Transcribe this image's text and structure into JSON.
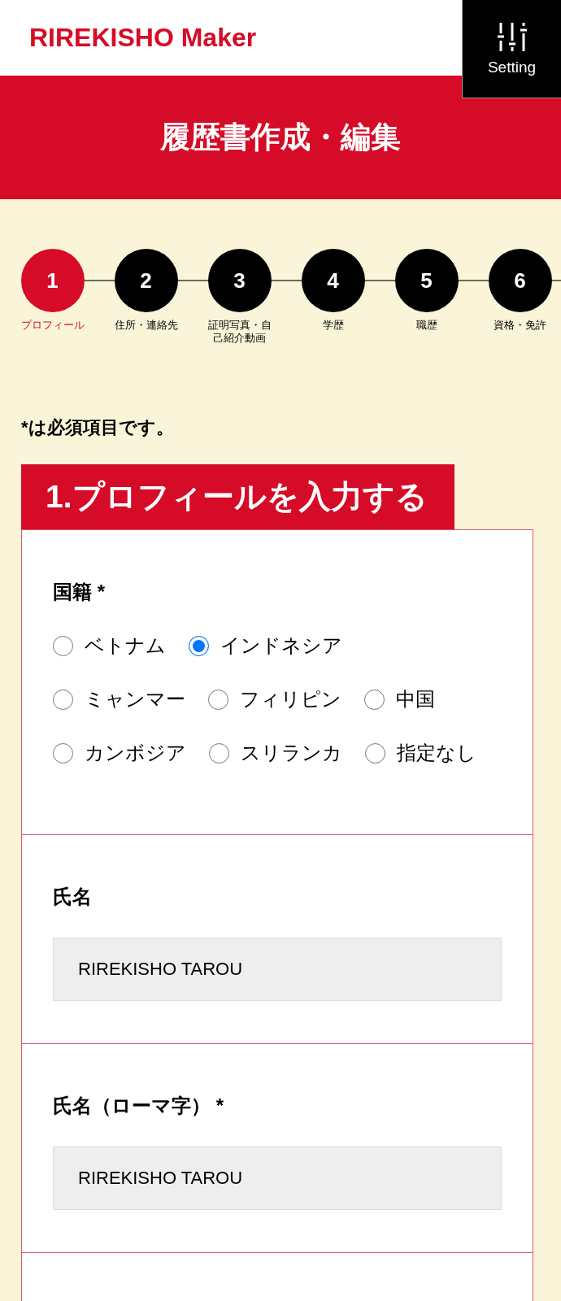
{
  "header": {
    "logo": "RIREKISHO Maker",
    "settings_button": {
      "label": "Setting"
    }
  },
  "banner": {
    "title": "履歴書作成・編集"
  },
  "steps": [
    {
      "number": "1",
      "label": "プロフィール",
      "selected": true
    },
    {
      "number": "2",
      "label": "住所・連絡先",
      "selected": false
    },
    {
      "number": "3",
      "label": "証明写真・自己紹介動画",
      "selected": false
    },
    {
      "number": "4",
      "label": "学歴",
      "selected": false
    },
    {
      "number": "5",
      "label": "職歴",
      "selected": false
    },
    {
      "number": "6",
      "label": "資格・免許",
      "selected": false
    }
  ],
  "required_note": "*は必須項目です。",
  "section": {
    "title": "1.プロフィールを入力する",
    "fields": [
      {
        "kind": "radio",
        "label": "国籍 *",
        "option_rows": [
          [
            {
              "label": "ベトナム",
              "selected": false
            },
            {
              "label": "インドネシア",
              "selected": true
            }
          ],
          [
            {
              "label": "ミャンマー",
              "selected": false
            },
            {
              "label": "フィリピン",
              "selected": false
            },
            {
              "label": "中国",
              "selected": false
            }
          ],
          [
            {
              "label": "カンボジア",
              "selected": false
            },
            {
              "label": "スリランカ",
              "selected": false
            },
            {
              "label": "指定なし",
              "selected": false
            }
          ]
        ]
      },
      {
        "kind": "text",
        "label": "氏名",
        "value": "RIREKISHO TAROU"
      },
      {
        "kind": "text",
        "label": "氏名（ローマ字） *",
        "value": "RIREKISHO TAROU"
      }
    ]
  }
}
